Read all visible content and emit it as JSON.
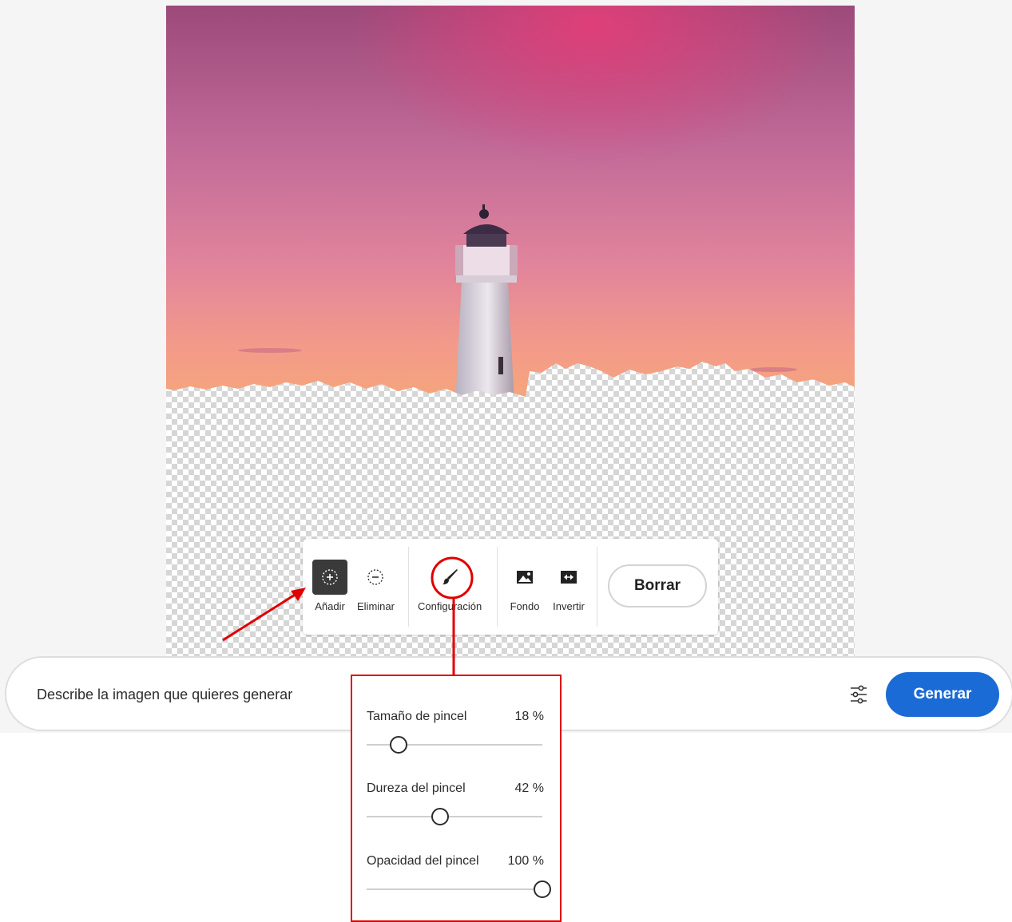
{
  "toolbar": {
    "tools": [
      {
        "label": "Añadir",
        "icon": "add-selection-icon",
        "active": true
      },
      {
        "label": "Eliminar",
        "icon": "subtract-selection-icon",
        "active": false
      },
      {
        "label": "Configuración",
        "icon": "brush-icon",
        "active": false
      },
      {
        "label": "Fondo",
        "icon": "image-icon",
        "active": false
      },
      {
        "label": "Invertir",
        "icon": "invert-icon",
        "active": false
      }
    ],
    "clear_label": "Borrar"
  },
  "prompt": {
    "placeholder": "Describe la imagen que quieres generar",
    "value": "",
    "settings_icon": "sliders-icon",
    "generate_label": "Generar"
  },
  "brush_settings": {
    "size": {
      "label": "Tamaño de pincel",
      "value_text": "18 %",
      "value": 18
    },
    "hardness": {
      "label": "Dureza del pincel",
      "value_text": "42 %",
      "value": 42
    },
    "opacity": {
      "label": "Opacidad del pincel",
      "value_text": "100 %",
      "value": 100
    }
  },
  "colors": {
    "primary_button": "#1a6bd6",
    "annotation": "#e00000",
    "active_tool": "#3a3a3a"
  }
}
